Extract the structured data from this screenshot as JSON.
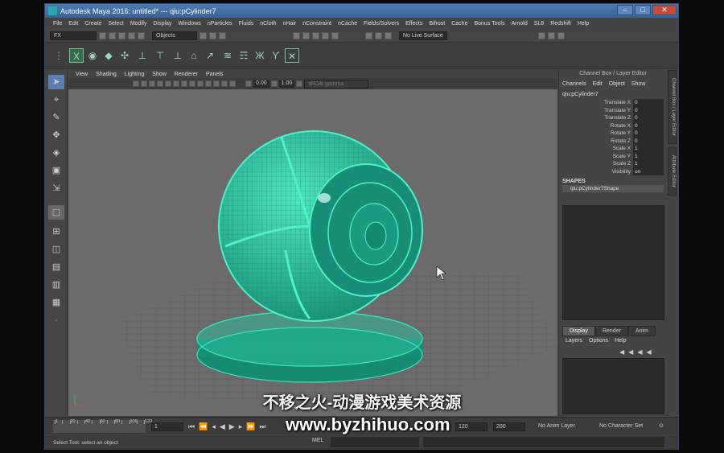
{
  "window": {
    "title": "Autodesk Maya 2016: untitled*  ---  qiu:pCylinder7",
    "min": "–",
    "max": "□",
    "close": "✕"
  },
  "menubar": [
    "File",
    "Edit",
    "Create",
    "Select",
    "Modify",
    "Display",
    "Windows",
    "nParticles",
    "Fluids",
    "nCloth",
    "nHair",
    "nConstraint",
    "nCache",
    "Fields/Solvers",
    "Effects",
    "Bifrost",
    "Cache",
    "Bonus Tools",
    "Arnold",
    "SL8",
    "Redshift",
    "Help"
  ],
  "statusline": {
    "menuset": "FX",
    "selection_mode": "Objects",
    "live_surface": "No Live Surface"
  },
  "viewport": {
    "menu": [
      "View",
      "Shading",
      "Lighting",
      "Show",
      "Renderer",
      "Panels"
    ],
    "near": "0.00",
    "far": "1.00",
    "colorspace": "sRGB gamma",
    "camera_label": "persp"
  },
  "channel_box": {
    "title": "Channel Box / Layer Editor",
    "menu": [
      "Channels",
      "Edit",
      "Object",
      "Show"
    ],
    "object": "qiu:pCylinder7",
    "attributes": [
      {
        "label": "Translate X",
        "value": "0"
      },
      {
        "label": "Translate Y",
        "value": "0"
      },
      {
        "label": "Translate Z",
        "value": "0"
      },
      {
        "label": "Rotate X",
        "value": "0"
      },
      {
        "label": "Rotate Y",
        "value": "0"
      },
      {
        "label": "Rotate Z",
        "value": "0"
      },
      {
        "label": "Scale X",
        "value": "1"
      },
      {
        "label": "Scale Y",
        "value": "1"
      },
      {
        "label": "Scale Z",
        "value": "1"
      },
      {
        "label": "Visibility",
        "value": "on"
      }
    ],
    "shapes_header": "SHAPES",
    "shape_name": "qiu:pCylinder7Shape",
    "side_tab_1": "Channel Box / Layer Editor",
    "side_tab_2": "Attribute Editor"
  },
  "layer_editor": {
    "tabs": [
      "Display",
      "Render",
      "Anim"
    ],
    "menu": [
      "Layers",
      "Options",
      "Help"
    ]
  },
  "timeline": {
    "ticks": [
      "1",
      "",
      "20",
      "",
      "40",
      "",
      "60",
      "",
      "80",
      "",
      "100",
      "",
      "120"
    ],
    "current_frame": "1",
    "start": "1",
    "range_start": "1",
    "range_end": "120",
    "end": "200",
    "anim_layer": "No Anim Layer",
    "character_set": "No Character Set"
  },
  "help_line": "Select Tool: select an object",
  "mel_label": "MEL",
  "overlay": {
    "line1": "不移之火-动漫游戏美术资源",
    "line2": "www.byzhihuo.com"
  }
}
